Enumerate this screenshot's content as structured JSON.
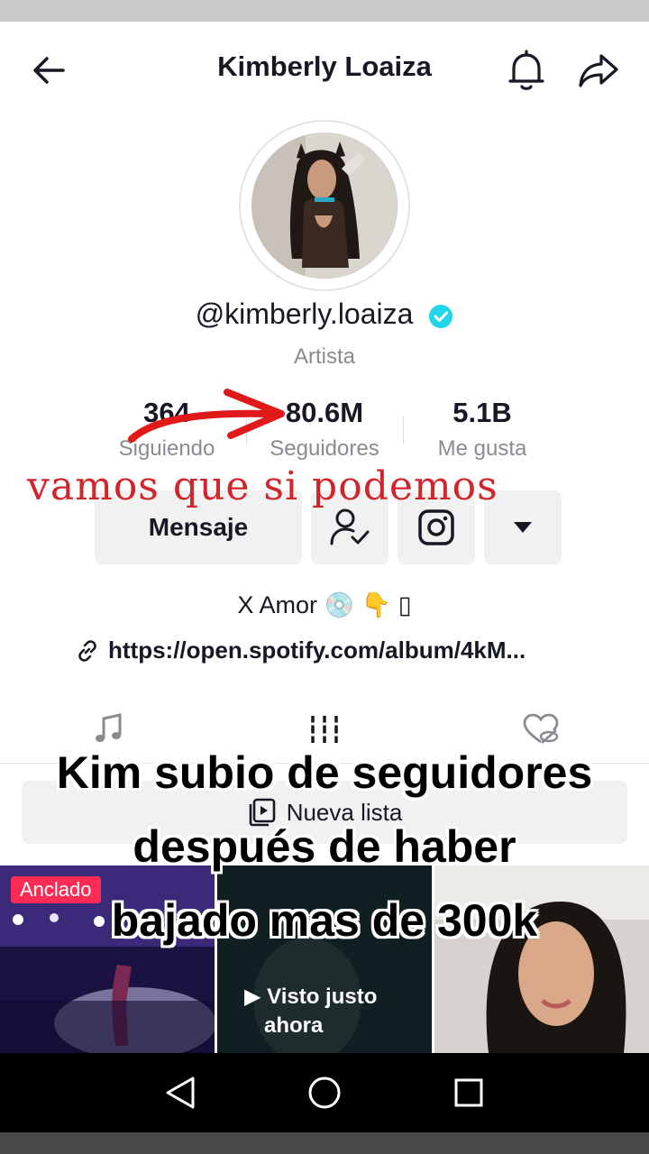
{
  "header": {
    "title": "Kimberly Loaiza",
    "back_icon": "arrow-left-icon",
    "bell_icon": "bell-icon",
    "share_icon": "share-icon"
  },
  "profile": {
    "handle": "@kimberly.loaiza",
    "verified": true,
    "role": "Artista"
  },
  "stats": [
    {
      "value": "364",
      "label": "Siguiendo"
    },
    {
      "value": "80.6M",
      "label": "Seguidores"
    },
    {
      "value": "5.1B",
      "label": "Me gusta"
    }
  ],
  "overlay_text": "vamos que si podemos",
  "actions": {
    "message_label": "Mensaje",
    "follow_icon": "user-check-icon",
    "instagram_icon": "instagram-icon",
    "more_icon": "caret-down-icon"
  },
  "bio": {
    "text": "X Amor 💿 👇 ▯",
    "link": "https://open.spotify.com/album/4kM..."
  },
  "tabs": [
    "music-note-icon",
    "grid-icon",
    "liked-hidden-icon"
  ],
  "new_list": {
    "label": "Nueva lista"
  },
  "caption": {
    "line1": "Kim subio de seguidores",
    "line2": "después de haber",
    "line3": "bajado mas de 300k"
  },
  "videos": [
    {
      "badge": "Anclado"
    },
    {
      "overlay": "Visto justo ahora",
      "line1": "Visto justo",
      "line2": "ahora"
    },
    {}
  ],
  "colors": {
    "accent": "#fe2c55",
    "verified": "#20d5ec",
    "overlay_red": "#d1252b"
  }
}
